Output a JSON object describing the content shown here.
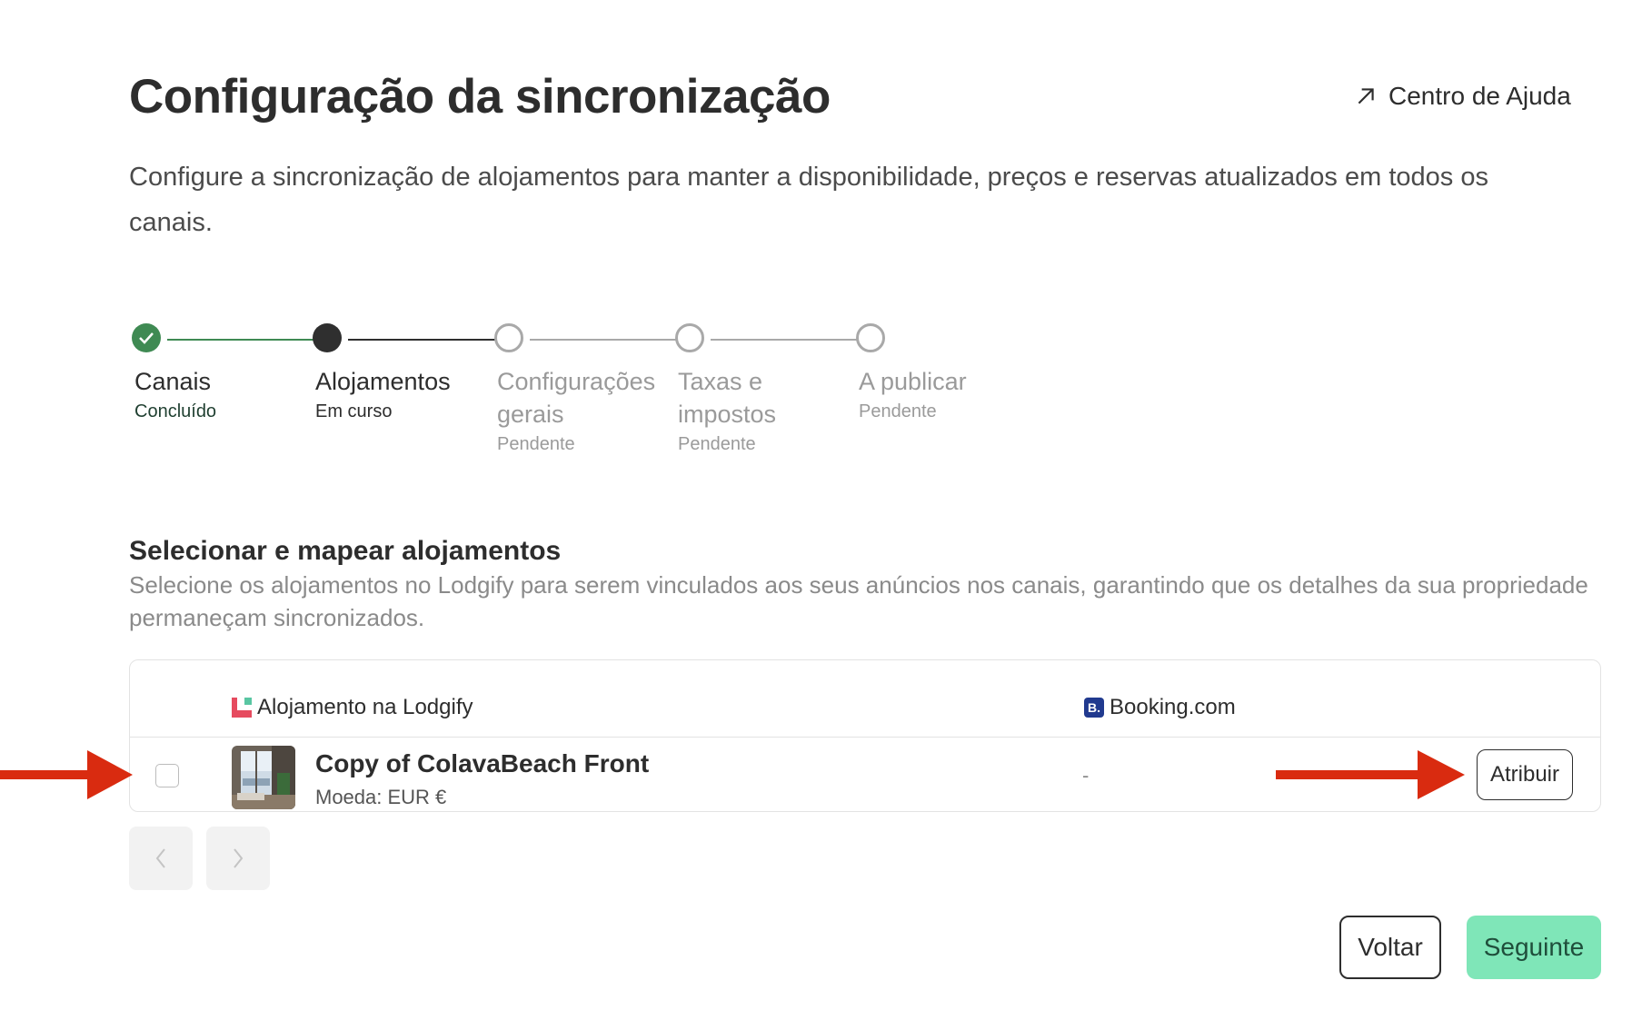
{
  "header": {
    "title": "Configuração da sincronização",
    "help_link": "Centro de Ajuda",
    "intro": "Configure a sincronização de alojamentos para manter a disponibilidade, preços e reservas atualizados em todos os canais."
  },
  "stepper": {
    "steps": [
      {
        "label": "Canais",
        "status": "Concluído",
        "state": "done"
      },
      {
        "label": "Alojamentos",
        "status": "Em curso",
        "state": "current"
      },
      {
        "label": "Configurações gerais",
        "status": "Pendente",
        "state": "pending"
      },
      {
        "label": "Taxas e impostos",
        "status": "Pendente",
        "state": "pending"
      },
      {
        "label": "A publicar",
        "status": "Pendente",
        "state": "pending"
      }
    ]
  },
  "section": {
    "title": "Selecionar e mapear alojamentos",
    "description": "Selecione os alojamentos no Lodgify para serem vinculados aos seus anúncios nos canais, garantindo que os detalhes da sua propriedade permaneçam sincronizados."
  },
  "table": {
    "col_lodgify": "Alojamento na Lodgify",
    "col_booking": "Booking.com",
    "booking_logo_text": "B.",
    "rows": [
      {
        "name": "Copy of ColavaBeach Front",
        "currency": "Moeda: EUR €",
        "booking_value": "-",
        "action": "Atribuir",
        "checked": false
      }
    ]
  },
  "footer": {
    "back_label": "Voltar",
    "next_label": "Seguinte"
  },
  "colors": {
    "done": "#3f8a53",
    "current": "#2f2f2f",
    "pending": "#a9a9a9",
    "primary_button": "#7fe6b8",
    "annotation_arrow": "#d92b10"
  }
}
